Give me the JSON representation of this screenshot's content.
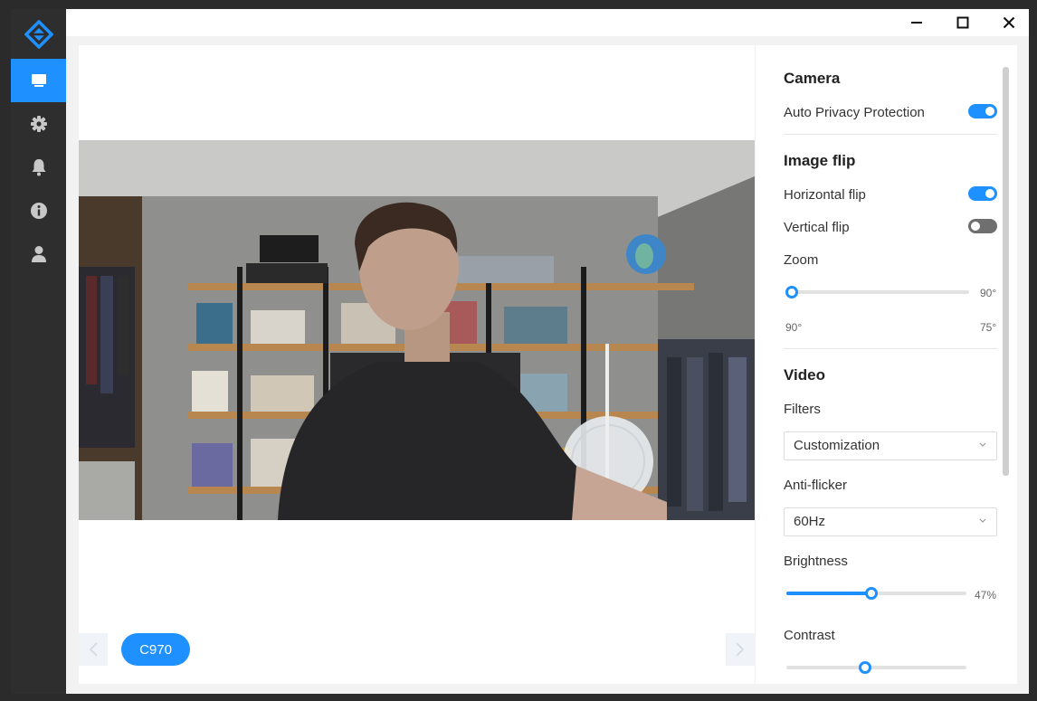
{
  "app": {
    "accent": "#1e90ff",
    "sidebar_bg": "#2e2e2e"
  },
  "sidebar": {
    "items": [
      {
        "icon": "monitor-icon",
        "active": true
      },
      {
        "icon": "gear-icon",
        "active": false
      },
      {
        "icon": "bell-icon",
        "active": false
      },
      {
        "icon": "info-icon",
        "active": false
      },
      {
        "icon": "user-icon",
        "active": false
      }
    ]
  },
  "stage": {
    "device_chip": "C970"
  },
  "panel": {
    "camera": {
      "title": "Camera",
      "auto_privacy_label": "Auto Privacy Protection",
      "auto_privacy_on": true
    },
    "image_flip": {
      "title": "Image flip",
      "horizontal_label": "Horizontal flip",
      "horizontal_on": true,
      "vertical_label": "Vertical flip",
      "vertical_on": false
    },
    "zoom": {
      "label": "Zoom",
      "value_text": "90°",
      "min_text": "90°",
      "max_text": "75°",
      "level": 0.0
    },
    "video": {
      "title": "Video",
      "filters_label": "Filters",
      "filters_value": "Customization",
      "antiflicker_label": "Anti-flicker",
      "antiflicker_value": "60Hz",
      "brightness_label": "Brightness",
      "brightness_value_text": "47%",
      "brightness_level": 0.47,
      "contrast_label": "Contrast"
    }
  }
}
